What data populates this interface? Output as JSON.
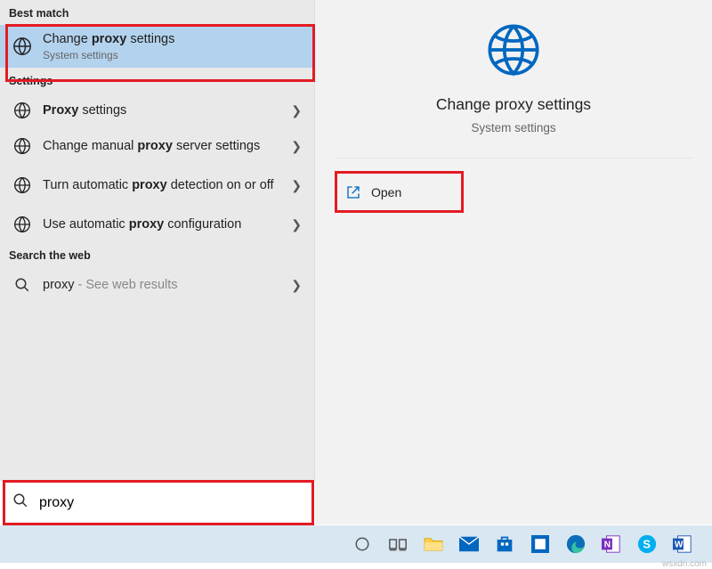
{
  "sections": {
    "best_match": "Best match",
    "settings": "Settings",
    "web": "Search the web"
  },
  "best_match": {
    "title_pre": "Change ",
    "title_bold": "proxy",
    "title_post": " settings",
    "subtitle": "System settings"
  },
  "settings_items": [
    {
      "pre": "",
      "bold": "Proxy",
      "post": " settings"
    },
    {
      "pre": "Change manual ",
      "bold": "proxy",
      "post": " server settings"
    },
    {
      "pre": "Turn automatic ",
      "bold": "proxy",
      "post": " detection on or off"
    },
    {
      "pre": "Use automatic ",
      "bold": "proxy",
      "post": " configuration"
    }
  ],
  "web_item": {
    "query": "proxy",
    "hint": " - See web results"
  },
  "detail": {
    "title": "Change proxy settings",
    "subtitle": "System settings",
    "open_label": "Open"
  },
  "search": {
    "value": "proxy"
  },
  "watermark": "wsxdn.com"
}
